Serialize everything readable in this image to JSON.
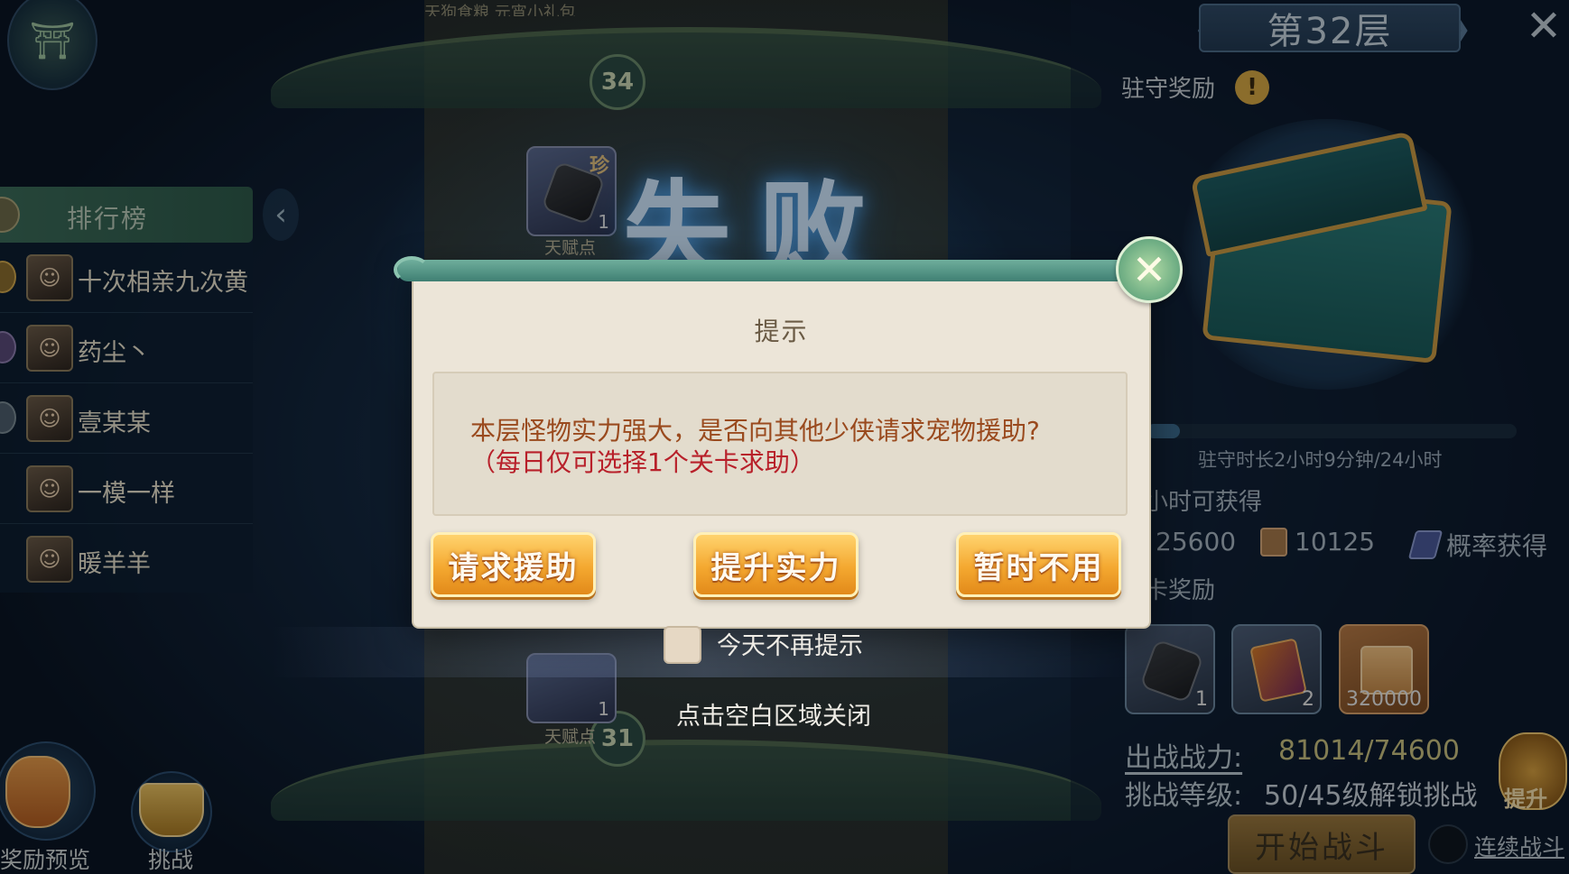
{
  "top_strip": {
    "text": "天狗食粮  元宵小礼包"
  },
  "tower": {
    "floor_badge_upper": "34",
    "floor_badge_lower": "31",
    "title_art": "失败",
    "item_upper": {
      "tag": "珍",
      "count": "1",
      "caption": "天赋点"
    },
    "item_lower": {
      "count": "1",
      "caption": "天赋点"
    }
  },
  "ranking": {
    "title": "排行榜",
    "rows": [
      {
        "name": "十次相亲九次黄"
      },
      {
        "name": "药尘丶"
      },
      {
        "name": "壹某某"
      },
      {
        "name": "一模一样"
      },
      {
        "name": "暖羊羊"
      }
    ]
  },
  "bottom_left": {
    "reward_preview_label": "奖励预览",
    "challenge_label": "挑战"
  },
  "right_panel": {
    "floor_title": "第32层",
    "garrison_reward_label": "驻守奖励",
    "garrison_time": "驻守时长2小时9分钟/24小时",
    "garrison_progress": 0.09,
    "per_hour_label": "小时可获得",
    "resources": [
      {
        "icon": "coin-icon",
        "value": "25600"
      },
      {
        "icon": "scroll-icon",
        "value": "10125"
      },
      {
        "icon": "feather-icon",
        "value": "概率获得"
      }
    ],
    "first_reward_label": "卡奖励",
    "reward_slots": [
      {
        "icon": "stone-icon",
        "count": "1"
      },
      {
        "icon": "book-icon",
        "count": "2"
      },
      {
        "icon": "scroll-icon",
        "count": "320000"
      }
    ],
    "power_label": "出战战力:",
    "power_value": "81014/74600",
    "level_label": "挑战等级:",
    "level_value": "50/45级解锁挑战",
    "boost_label": "提升",
    "start_button": "开始战斗",
    "continue_label": "连续战斗"
  },
  "dialog": {
    "title": "提示",
    "message": "本层怪物实力强大，是否向其他少侠请求宠物援助?",
    "note": "（每日仅可选择1个关卡求助）",
    "buttons": {
      "request_help": "请求援助",
      "improve_power": "提升实力",
      "not_now": "暂时不用"
    },
    "dont_remind_label": "今天不再提示",
    "tap_to_close": "点击空白区域关闭"
  },
  "colors": {
    "dialog_bg": "#ece5d8",
    "button_gold": "#f4a830",
    "message_text": "#9a4a1e",
    "note_text": "#b8202a",
    "dialog_bar": "#3f7f73"
  }
}
